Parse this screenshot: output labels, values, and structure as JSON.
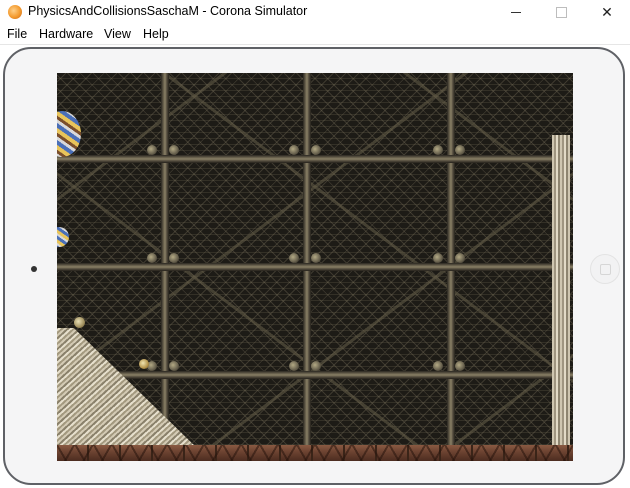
{
  "window": {
    "title": "PhysicsAndCollisionsSaschaM - Corona Simulator",
    "icon": "corona-app-icon",
    "controls": [
      "minimize-icon",
      "maximize-icon",
      "close-icon"
    ]
  },
  "menu": {
    "file": "File",
    "hardware": "Hardware",
    "view": "View",
    "help": "Help"
  },
  "device": {
    "type": "tablet-landscape",
    "home_button_icon": "home-button-icon",
    "camera_icon": "front-camera-dot"
  },
  "game": {
    "scene": "physics-collisions",
    "background": "metal-mesh-grid",
    "objects": [
      "large-striped-ball",
      "medium-striped-ball",
      "small-ball",
      "small-ball",
      "wooden-ramp",
      "wooden-post",
      "floor-girder"
    ],
    "colors": {
      "mesh_dark": "#1d1b16",
      "beam": "#8a8166",
      "floor": "#6e4432",
      "wood": "#cfc6b0"
    }
  }
}
